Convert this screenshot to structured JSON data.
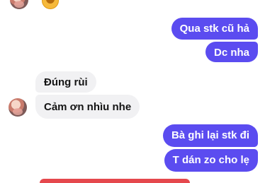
{
  "chat": {
    "messages": [
      {
        "direction": "outgoing",
        "text": "Qua stk cũ hả"
      },
      {
        "direction": "outgoing",
        "text": "Dc nha"
      },
      {
        "direction": "incoming",
        "text": "Đúng rùi"
      },
      {
        "direction": "incoming",
        "text": "Cảm ơn nhìu nhe"
      },
      {
        "direction": "outgoing",
        "text": "Bà ghi lại stk đi"
      },
      {
        "direction": "outgoing",
        "text": "T dán zo cho lẹ"
      }
    ],
    "outgoing_color": "#5b4cf0",
    "incoming_color": "#f1f1f3"
  }
}
